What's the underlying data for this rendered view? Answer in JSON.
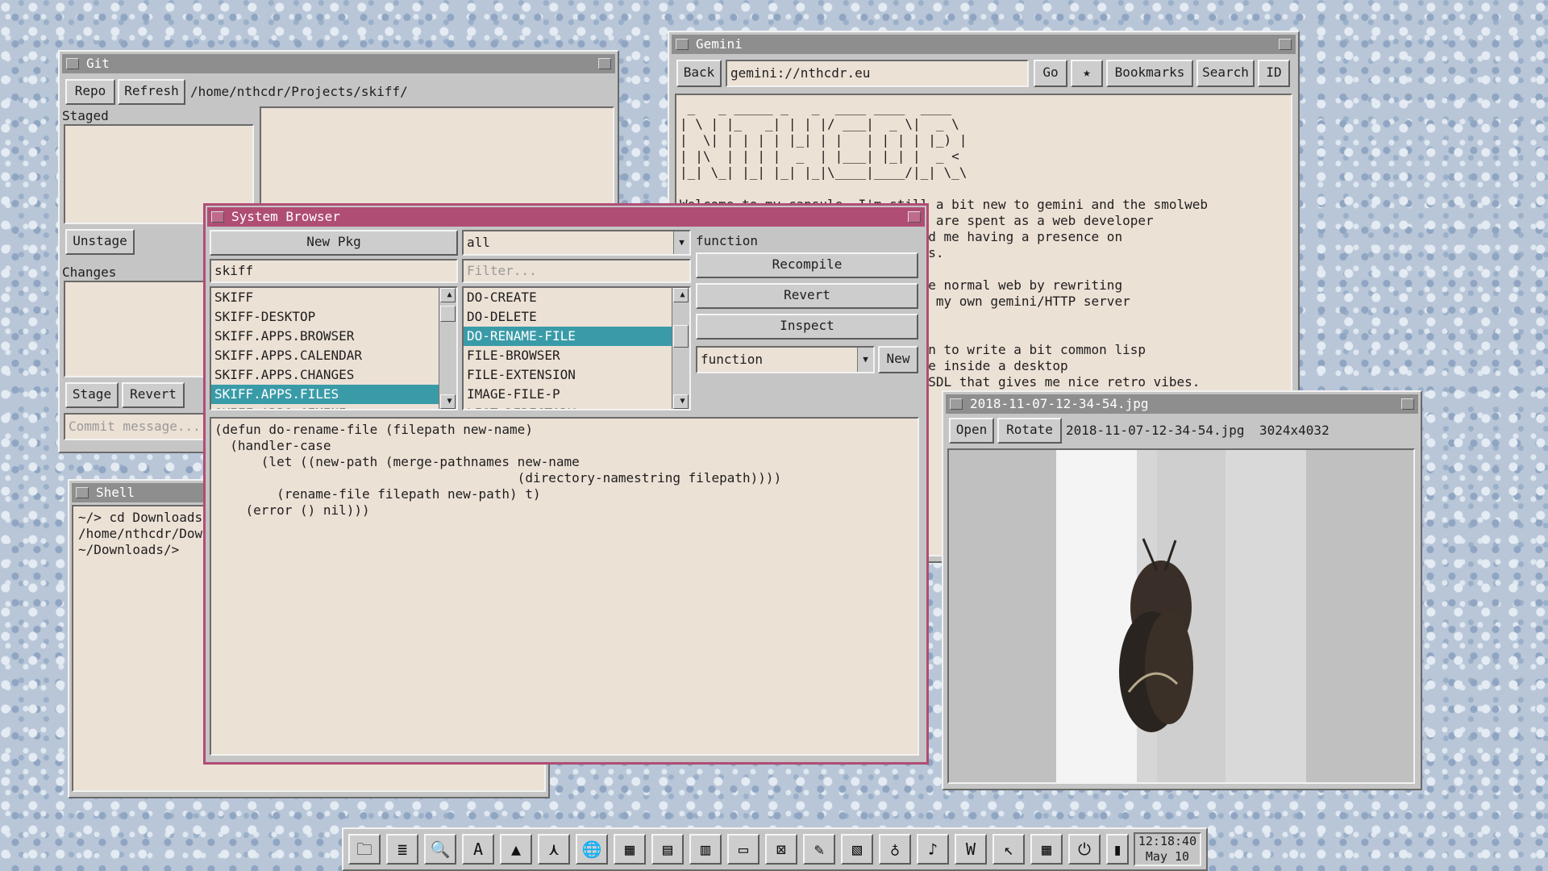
{
  "git": {
    "title": "Git",
    "repo_btn": "Repo",
    "refresh_btn": "Refresh",
    "path": "/home/nthcdr/Projects/skiff/",
    "staged_label": "Staged",
    "unstage_btn": "Unstage",
    "changes_label": "Changes",
    "stage_btn": "Stage",
    "revert_btn": "Revert",
    "commit_placeholder": "Commit message..."
  },
  "shell": {
    "title": "Shell",
    "output": "~/> cd Downloads\n/home/nthcdr/Dow\n~/Downloads/>"
  },
  "gemini": {
    "title": "Gemini",
    "back_btn": "Back",
    "url": "gemini://nthcdr.eu",
    "go_btn": "Go",
    "star_icon": "★",
    "bookmarks_btn": "Bookmarks",
    "search_btn": "Search",
    "id_btn": "ID",
    "content": " _   _ _____ _   _  ____ ____  ____\n| \\ | |_   _| | | |/ ___|  _ \\|  _ \\\n|  \\| | | | | |_| | |   | | | | |_) |\n| |\\  | | | |  _  | |___| |_| |  _ <\n|_| \\_| |_| |_| |_|\\____|____/|_| \\_\\\n\nWelcome to my capsule. I'm still a bit new to gemini and the smolweb\nscene, and the internet. My days are spent as a web developer\nwhich is the driving force behind me having a presence on\ngemini, for its simple aesthetics.\n\nThis capsule is accessible on the normal web by rewriting\nthe request that is performed by my own gemini/HTTP server\nrunning on my raspberry pi.\n\nIn my free time I have been known to write a bit common lisp\nand I am currently trying to live inside a desktop\nenvironment written in lisp and SDL that gives me nice retro vibes.\n\nYou can find me on"
  },
  "browser": {
    "title": "System Browser",
    "new_pkg_btn": "New Pkg",
    "package_field": "skiff",
    "packages": [
      "SKIFF",
      "SKIFF-DESKTOP",
      "SKIFF.APPS.BROWSER",
      "SKIFF.APPS.CALENDAR",
      "SKIFF.APPS.CHANGES",
      "SKIFF.APPS.FILES",
      "SKIFF.APPS.GEMINI"
    ],
    "selected_package": "SKIFF.APPS.FILES",
    "filter_select": "all",
    "filter_placeholder": "Filter...",
    "definitions": [
      "DO-CREATE",
      "DO-DELETE",
      "DO-RENAME-FILE",
      "FILE-BROWSER",
      "FILE-EXTENSION",
      "IMAGE-FILE-P",
      "LIST-DIRECTORY"
    ],
    "selected_definition": "DO-RENAME-FILE",
    "kind_label": "function",
    "recompile_btn": "Recompile",
    "revert_btn": "Revert",
    "inspect_btn": "Inspect",
    "kind_select": "function",
    "new_btn": "New",
    "code": "(defun do-rename-file (filepath new-name)\n  (handler-case\n      (let ((new-path (merge-pathnames new-name\n                                       (directory-namestring filepath))))\n        (rename-file filepath new-path) t)\n    (error () nil)))"
  },
  "image_viewer": {
    "title": "2018-11-07-12-34-54.jpg",
    "open_btn": "Open",
    "rotate_btn": "Rotate",
    "filename": "2018-11-07-12-34-54.jpg",
    "dimensions": "3024x4032"
  },
  "taskbar": {
    "icons": [
      "folder-icon",
      "document-icon",
      "magnifier-icon",
      "font-icon",
      "triangle-icon",
      "graph-icon",
      "globe-icon",
      "window-grid-icon",
      "form-icon",
      "book-icon",
      "terminal-icon",
      "mail-icon",
      "notepad-icon",
      "archive-icon",
      "glass-icon",
      "music-note-icon",
      "wordprocessor-icon",
      "cursor-icon",
      "calendar-icon",
      "power-icon",
      "battery-icon"
    ],
    "glyphs": [
      "🗀",
      "≣",
      "🔍",
      "A",
      "▲",
      "⋏",
      "🌐",
      "▦",
      "▤",
      "▥",
      "▭",
      "⊠",
      "✎",
      "▧",
      "♁",
      "♪",
      "W",
      "↖",
      "▦",
      "⏻",
      "▮"
    ],
    "time": "12:18:40",
    "date": "May 10"
  },
  "colors": {
    "desktop": "#b8c6d8",
    "active_title": "#b04d75",
    "inactive_title": "#8e8e8e",
    "panel_bg": "#ece1d5",
    "selection": "#3a9ba8"
  }
}
